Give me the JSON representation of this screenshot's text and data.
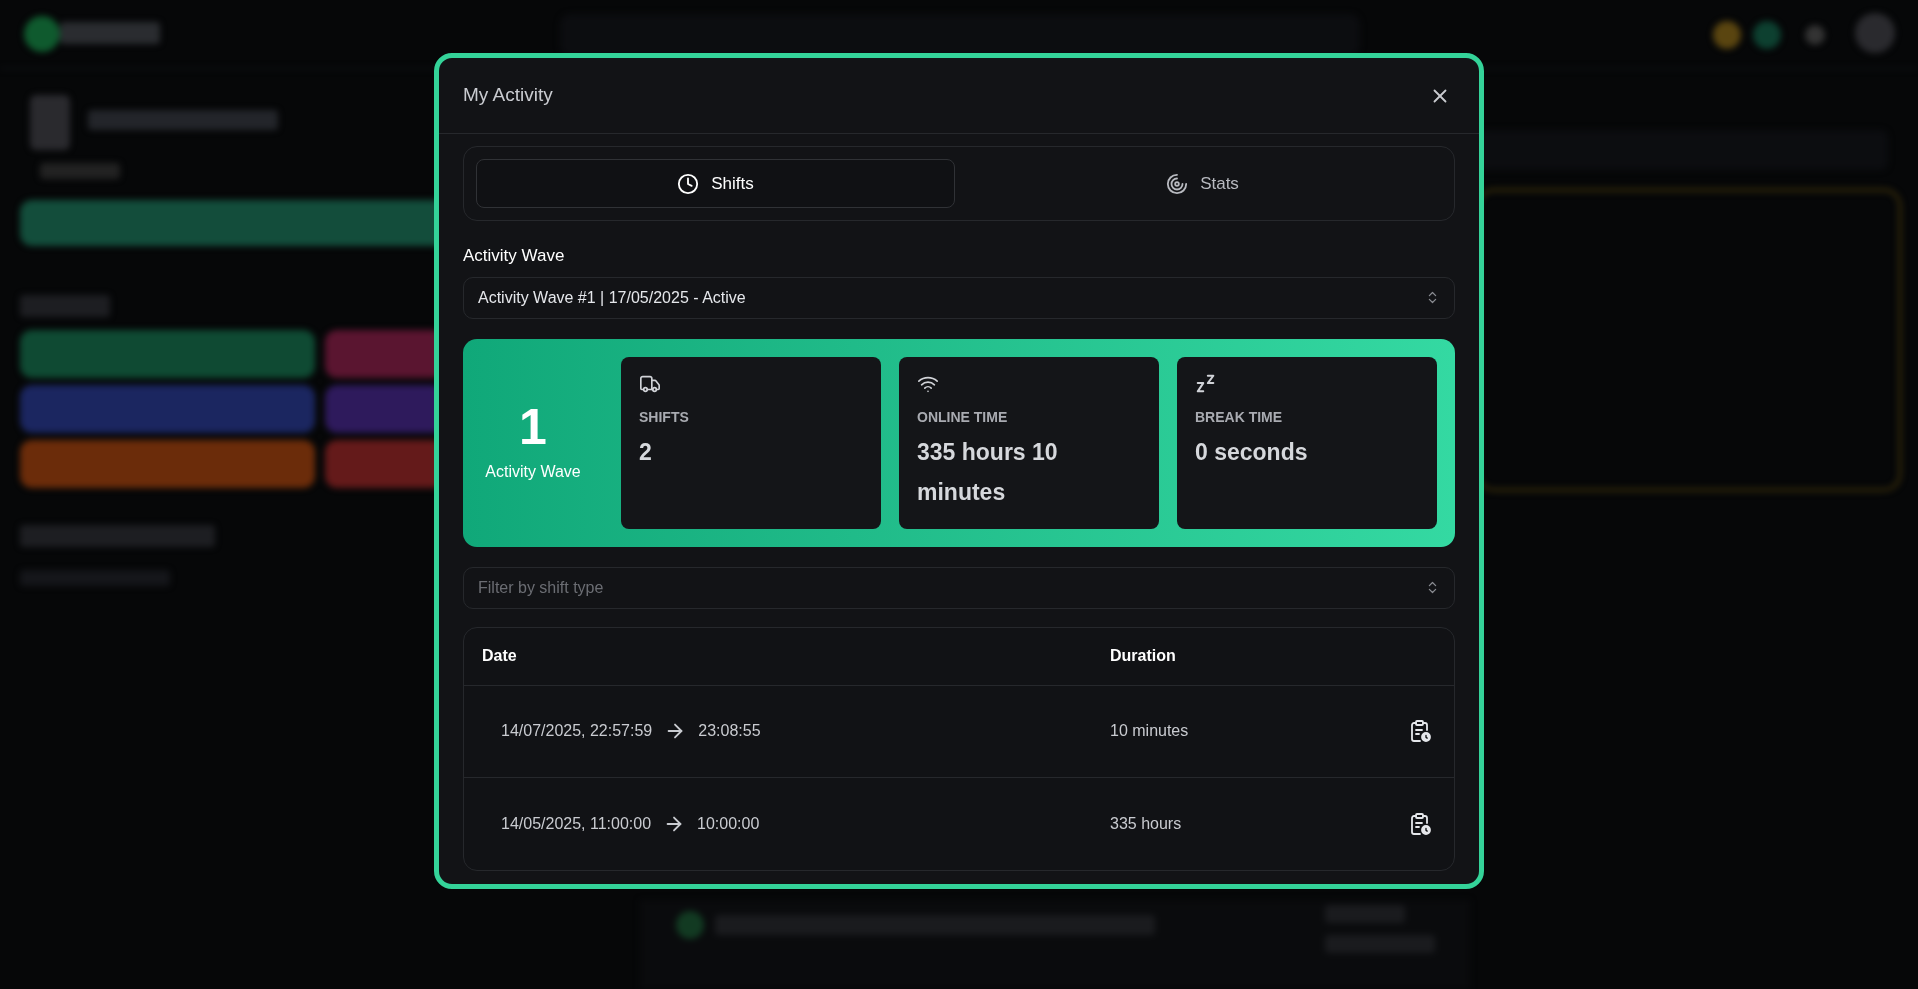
{
  "dialog": {
    "title": "My Activity"
  },
  "tabs": [
    {
      "label": "Shifts",
      "kind": "clock",
      "selected": true
    },
    {
      "label": "Stats",
      "kind": "target",
      "selected": false
    }
  ],
  "activity_wave_select": {
    "label": "Activity Wave",
    "value": "Activity Wave #1 | 17/05/2025 - Active"
  },
  "summary": {
    "number": "1",
    "caption": "Activity Wave",
    "stats": [
      {
        "kind": "truck",
        "label": "SHIFTS",
        "value": "2"
      },
      {
        "kind": "wifi",
        "label": "ONLINE TIME",
        "value": "335 hours 10 minutes"
      },
      {
        "kind": "sleep",
        "label": "BREAK TIME",
        "value": "0 seconds"
      }
    ]
  },
  "shift_filter": {
    "placeholder": "Filter by shift type"
  },
  "table": {
    "columns": [
      "Date",
      "Duration"
    ],
    "rows": [
      {
        "start": "14/07/2025, 22:57:59",
        "end": "23:08:55",
        "duration": "10 minutes"
      },
      {
        "start": "14/05/2025, 11:00:00",
        "end": "10:00:00",
        "duration": "335 hours"
      }
    ]
  }
}
